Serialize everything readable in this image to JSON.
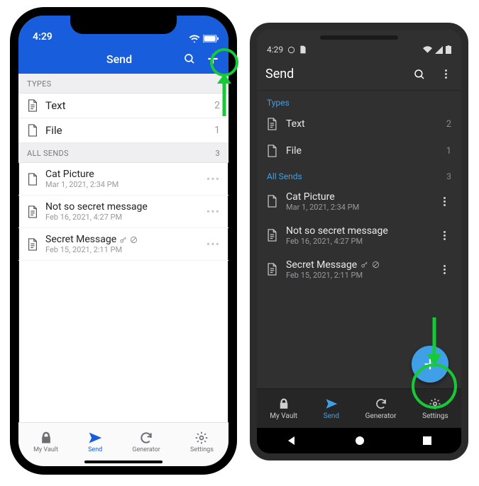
{
  "ios": {
    "status": {
      "time": "4:29"
    },
    "header": {
      "title": "Send"
    },
    "sections": {
      "types": {
        "label": "TYPES",
        "items": [
          {
            "label": "Text",
            "count": "2",
            "icon": "text-file-icon"
          },
          {
            "label": "File",
            "count": "1",
            "icon": "file-icon"
          }
        ]
      },
      "all": {
        "label": "ALL SENDS",
        "count": "3",
        "items": [
          {
            "name": "Cat Picture",
            "date": "Mar 1, 2021, 2:34 PM",
            "icon": "file-icon",
            "badges": []
          },
          {
            "name": "Not so secret message",
            "date": "Feb 16, 2021, 4:27 PM",
            "icon": "text-file-icon",
            "badges": []
          },
          {
            "name": "Secret Message",
            "date": "Feb 15, 2021, 2:11 PM",
            "icon": "text-file-icon",
            "badges": [
              "key",
              "disabled"
            ]
          }
        ]
      }
    },
    "tabs": [
      {
        "label": "My Vault",
        "icon": "lock-icon",
        "active": false
      },
      {
        "label": "Send",
        "icon": "paper-plane-icon",
        "active": true
      },
      {
        "label": "Generator",
        "icon": "refresh-icon",
        "active": false
      },
      {
        "label": "Settings",
        "icon": "gear-icon",
        "active": false
      }
    ]
  },
  "android": {
    "status": {
      "time": "4:29"
    },
    "header": {
      "title": "Send"
    },
    "sections": {
      "types": {
        "label": "Types",
        "items": [
          {
            "label": "Text",
            "count": "2",
            "icon": "text-file-icon"
          },
          {
            "label": "File",
            "count": "1",
            "icon": "file-icon"
          }
        ]
      },
      "all": {
        "label": "All Sends",
        "count": "3",
        "items": [
          {
            "name": "Cat Picture",
            "date": "Mar 1, 2021, 2:34 PM",
            "icon": "file-icon",
            "badges": []
          },
          {
            "name": "Not so secret message",
            "date": "Feb 16, 2021, 4:27 PM",
            "icon": "text-file-icon",
            "badges": []
          },
          {
            "name": "Secret Message",
            "date": "Feb 15, 2021, 2:11 PM",
            "icon": "text-file-icon",
            "badges": [
              "key",
              "disabled"
            ]
          }
        ]
      }
    },
    "tabs": [
      {
        "label": "My Vault",
        "icon": "lock-icon",
        "active": false
      },
      {
        "label": "Send",
        "icon": "paper-plane-icon",
        "active": true
      },
      {
        "label": "Generator",
        "icon": "refresh-icon",
        "active": false
      },
      {
        "label": "Settings",
        "icon": "gear-icon",
        "active": false
      }
    ]
  }
}
